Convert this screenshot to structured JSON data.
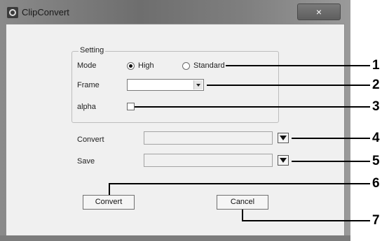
{
  "window": {
    "title": "ClipConvert",
    "close_glyph": "×"
  },
  "setting_group": {
    "legend": "Setting",
    "mode": {
      "label": "Mode",
      "options": [
        {
          "label": "High",
          "selected": true
        },
        {
          "label": "Standard",
          "selected": false
        }
      ]
    },
    "frame": {
      "label": "Frame",
      "value": ""
    },
    "alpha": {
      "label": "alpha",
      "checked": false
    }
  },
  "convert_row": {
    "label": "Convert",
    "value": ""
  },
  "save_row": {
    "label": "Save",
    "value": ""
  },
  "buttons": {
    "convert": "Convert",
    "cancel": "Cancel"
  },
  "callouts": [
    "1",
    "2",
    "3",
    "4",
    "5",
    "6",
    "7"
  ]
}
